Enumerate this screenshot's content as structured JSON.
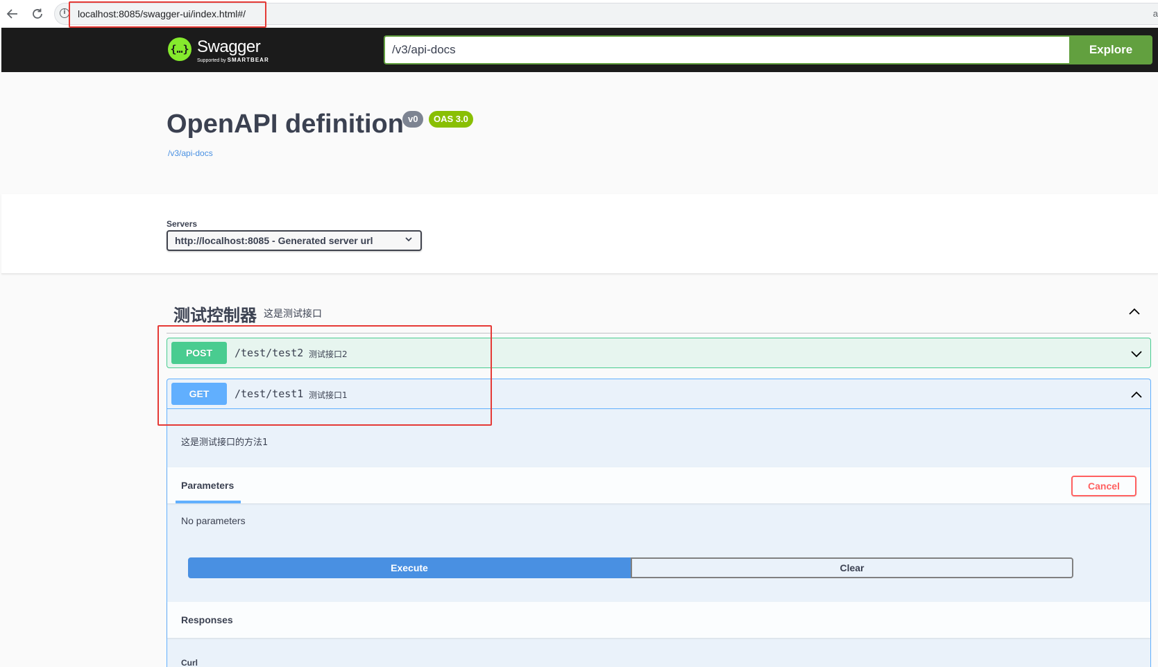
{
  "browser": {
    "url": "localhost:8085/swagger-ui/index.html#/",
    "edge_char": "a"
  },
  "topbar": {
    "logo_mark": "{…}",
    "logo_name": "Swagger",
    "logo_sub_prefix": "Supported by",
    "logo_sub_brand": "SMARTBEAR",
    "spec_url": "/v3/api-docs",
    "explore_label": "Explore"
  },
  "info": {
    "title": "OpenAPI definition",
    "version_badge": "v0",
    "oas_badge": "OAS 3.0",
    "link": "/v3/api-docs"
  },
  "servers": {
    "label": "Servers",
    "selected": "http://localhost:8085 - Generated server url"
  },
  "tag": {
    "name": "测试控制器",
    "description": "这是测试接口"
  },
  "operations": [
    {
      "method": "POST",
      "path": "/test/test2",
      "summary": "测试接口2",
      "expanded": false
    },
    {
      "method": "GET",
      "path": "/test/test1",
      "summary": "测试接口1",
      "expanded": true
    }
  ],
  "expanded_op": {
    "description": "这是测试接口的方法1",
    "parameters_tab": "Parameters",
    "cancel_label": "Cancel",
    "no_parameters": "No parameters",
    "execute_label": "Execute",
    "clear_label": "Clear",
    "responses_label": "Responses",
    "curl_label": "Curl"
  },
  "colors": {
    "topbar_bg": "#1b1b1b",
    "accent_green": "#62a03f",
    "post": "#49cc90",
    "get": "#61affe",
    "execute": "#4990e2",
    "cancel": "#ff6060",
    "highlight": "#e53935"
  }
}
